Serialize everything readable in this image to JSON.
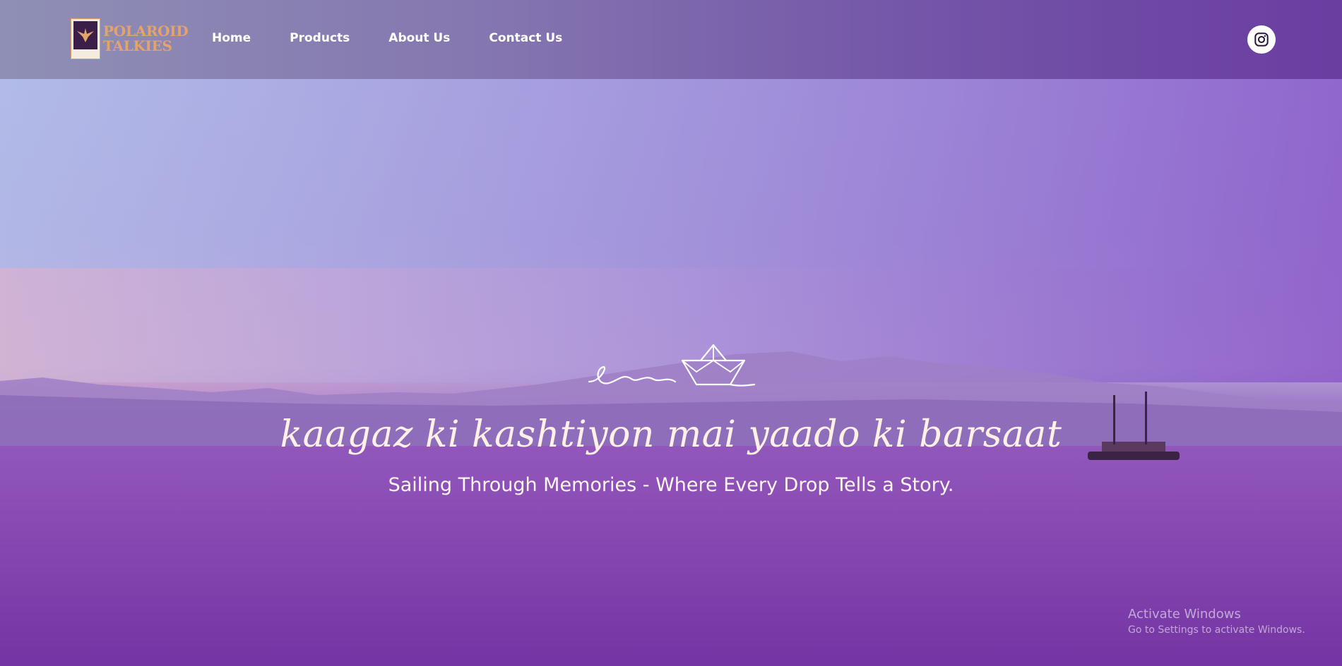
{
  "brand": {
    "name_line1": "POLAROID",
    "name_line2": "TALKIES",
    "accent_color": "#e3a36b"
  },
  "nav": {
    "items": [
      {
        "label": "Home"
      },
      {
        "label": "Products"
      },
      {
        "label": "About Us"
      },
      {
        "label": "Contact Us"
      }
    ],
    "social_icon": "instagram-icon"
  },
  "hero": {
    "tagline": "kaagaz ki kashtiyon mai yaado ki barsaat",
    "subtitle": "Sailing Through Memories - Where Every Drop Tells a Story.",
    "doodle_icon": "paper-boat-icon"
  },
  "os_watermark": {
    "title": "Activate Windows",
    "subtitle": "Go to Settings to activate Windows."
  }
}
